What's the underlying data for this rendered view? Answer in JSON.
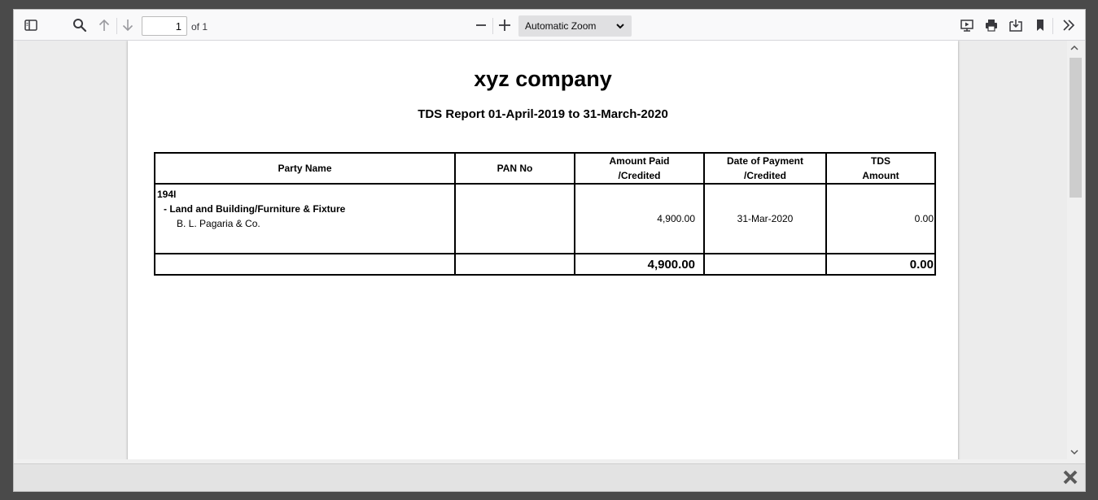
{
  "toolbar": {
    "page_number": "1",
    "page_count": "of 1",
    "zoom_value": "Automatic Zoom"
  },
  "document": {
    "company": "xyz company",
    "report_title": "TDS Report 01-April-2019 to 31-March-2020",
    "headers": {
      "party_name": "Party Name",
      "pan_no": "PAN No",
      "amount_paid_1": "Amount Paid",
      "amount_paid_2": "/Credited",
      "date_payment_1": "Date of Payment",
      "date_payment_2": "/Credited",
      "tds_amount_1": "TDS",
      "tds_amount_2": "Amount"
    },
    "row": {
      "section": "194I",
      "category": "- Land and Building/Furniture & Fixture",
      "party": "B. L. Pagaria & Co.",
      "pan": "",
      "amount": "4,900.00",
      "date": "31-Mar-2020",
      "tds": "0.00"
    },
    "totals": {
      "amount": "4,900.00",
      "tds": "0.00"
    }
  },
  "icons": {
    "sidebar_toggle": "sidebar-toggle-icon",
    "search": "search-icon",
    "prev": "arrow-up-icon",
    "next": "arrow-down-icon",
    "zoom_out": "minus-icon",
    "zoom_in": "plus-icon",
    "presentation": "presentation-mode-icon",
    "print": "print-icon",
    "download": "download-icon",
    "bookmark": "bookmark-icon",
    "tools": "double-chevron-right-icon",
    "close": "close-icon"
  }
}
